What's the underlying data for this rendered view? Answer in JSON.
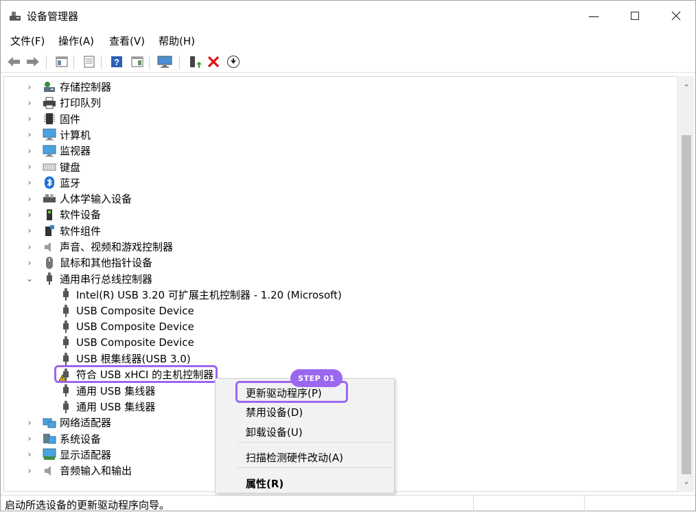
{
  "window": {
    "title": "设备管理器"
  },
  "menu": [
    "文件(F)",
    "操作(A)",
    "查看(V)",
    "帮助(H)"
  ],
  "tree": [
    {
      "label": "存储控制器",
      "icon": "storage-controller-icon",
      "expanded": false,
      "level": 0
    },
    {
      "label": "打印队列",
      "icon": "printer-icon",
      "expanded": false,
      "level": 0
    },
    {
      "label": "固件",
      "icon": "firmware-icon",
      "expanded": false,
      "level": 0
    },
    {
      "label": "计算机",
      "icon": "computer-icon",
      "expanded": false,
      "level": 0
    },
    {
      "label": "监视器",
      "icon": "monitor-icon",
      "expanded": false,
      "level": 0
    },
    {
      "label": "键盘",
      "icon": "keyboard-icon",
      "expanded": false,
      "level": 0
    },
    {
      "label": "蓝牙",
      "icon": "bluetooth-icon",
      "expanded": false,
      "level": 0
    },
    {
      "label": "人体学输入设备",
      "icon": "hid-icon",
      "expanded": false,
      "level": 0
    },
    {
      "label": "软件设备",
      "icon": "software-device-icon",
      "expanded": false,
      "level": 0
    },
    {
      "label": "软件组件",
      "icon": "software-component-icon",
      "expanded": false,
      "level": 0
    },
    {
      "label": "声音、视频和游戏控制器",
      "icon": "speaker-icon",
      "expanded": false,
      "level": 0
    },
    {
      "label": "鼠标和其他指针设备",
      "icon": "mouse-icon",
      "expanded": false,
      "level": 0
    },
    {
      "label": "通用串行总线控制器",
      "icon": "usb-icon",
      "expanded": true,
      "level": 0
    },
    {
      "label": "Intel(R) USB 3.20 可扩展主机控制器 - 1.20 (Microsoft)",
      "icon": "usb-icon",
      "level": 1
    },
    {
      "label": "USB Composite Device",
      "icon": "usb-icon",
      "level": 1
    },
    {
      "label": "USB Composite Device",
      "icon": "usb-icon",
      "level": 1
    },
    {
      "label": "USB Composite Device",
      "icon": "usb-icon",
      "level": 1
    },
    {
      "label": "USB 根集线器(USB 3.0)",
      "icon": "usb-icon",
      "level": 1
    },
    {
      "label": "符合 USB xHCI 的主机控制器",
      "icon": "usb-warning-icon",
      "level": 1,
      "selected": true
    },
    {
      "label": "通用 USB 集线器",
      "icon": "usb-icon",
      "level": 1
    },
    {
      "label": "通用 USB 集线器",
      "icon": "usb-icon",
      "level": 1
    },
    {
      "label": "网络适配器",
      "icon": "network-adapter-icon",
      "expanded": false,
      "level": 0
    },
    {
      "label": "系统设备",
      "icon": "system-device-icon",
      "expanded": false,
      "level": 0
    },
    {
      "label": "显示适配器",
      "icon": "display-adapter-icon",
      "expanded": false,
      "level": 0
    },
    {
      "label": "音频输入和输出",
      "icon": "audio-io-icon",
      "expanded": false,
      "level": 0
    }
  ],
  "context_menu": {
    "items": [
      "更新驱动程序(P)",
      "禁用设备(D)",
      "卸载设备(U)",
      "扫描检测硬件改动(A)",
      "属性(R)"
    ]
  },
  "step_badge": "STEP 01",
  "status": "启动所选设备的更新驱动程序向导。",
  "colors": {
    "highlight": "#9a67f0"
  }
}
